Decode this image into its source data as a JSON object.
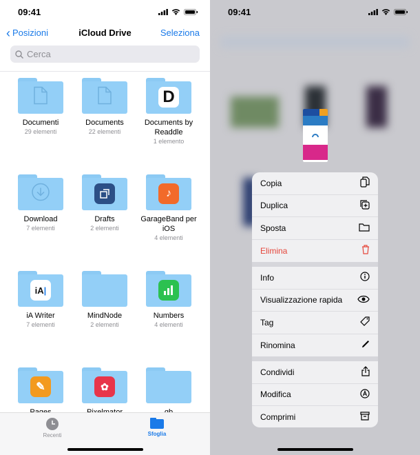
{
  "status": {
    "time": "09:41"
  },
  "nav": {
    "back": "Posizioni",
    "title": "iCloud Drive",
    "select": "Seleziona"
  },
  "search": {
    "placeholder": "Cerca"
  },
  "folders": [
    {
      "name": "Documenti",
      "count": "29 elementi",
      "icon": "doc"
    },
    {
      "name": "Documents",
      "count": "22 elementi",
      "icon": "doc"
    },
    {
      "name": "Documents by Readdle",
      "count": "1 elemento",
      "icon": "readdle"
    },
    {
      "name": "Download",
      "count": "7 elementi",
      "icon": "download"
    },
    {
      "name": "Drafts",
      "count": "2 elementi",
      "icon": "drafts"
    },
    {
      "name": "GarageBand per iOS",
      "count": "4 elementi",
      "icon": "garageband"
    },
    {
      "name": "iA Writer",
      "count": "7 elementi",
      "icon": "iawriter"
    },
    {
      "name": "MindNode",
      "count": "2 elementi",
      "icon": "none"
    },
    {
      "name": "Numbers",
      "count": "4 elementi",
      "icon": "numbers"
    },
    {
      "name": "Pages",
      "count": "",
      "icon": "pages"
    },
    {
      "name": "Pixelmator",
      "count": "",
      "icon": "pixelmator"
    },
    {
      "name": "qb",
      "count": "",
      "icon": "none"
    }
  ],
  "tabbar": {
    "recent": "Recenti",
    "browse": "Sfoglia"
  },
  "context_menu": {
    "groups": [
      [
        {
          "label": "Copia",
          "icon": "copy-icon"
        },
        {
          "label": "Duplica",
          "icon": "duplicate-icon"
        },
        {
          "label": "Sposta",
          "icon": "folder-icon"
        },
        {
          "label": "Elimina",
          "icon": "trash-icon",
          "danger": true
        }
      ],
      [
        {
          "label": "Info",
          "icon": "info-icon"
        },
        {
          "label": "Visualizzazione rapida",
          "icon": "eye-icon"
        },
        {
          "label": "Tag",
          "icon": "tag-icon"
        },
        {
          "label": "Rinomina",
          "icon": "pencil-icon"
        }
      ],
      [
        {
          "label": "Condividi",
          "icon": "share-icon"
        },
        {
          "label": "Modifica",
          "icon": "markup-icon"
        },
        {
          "label": "Comprimi",
          "icon": "archive-icon"
        }
      ]
    ]
  },
  "colors": {
    "accent": "#1a7ae8",
    "danger": "#e5463b",
    "folder": "#93cff7"
  }
}
